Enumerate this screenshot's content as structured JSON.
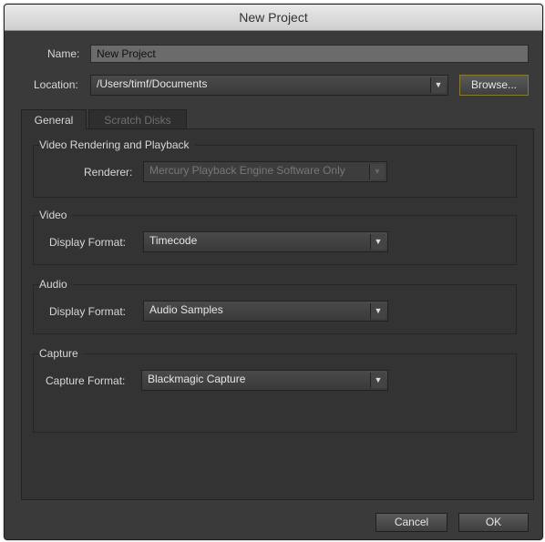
{
  "window": {
    "title": "New Project"
  },
  "name": {
    "label": "Name:",
    "value": "New Project"
  },
  "location": {
    "label": "Location:",
    "value": "/Users/timf/Documents",
    "browse_label": "Browse..."
  },
  "tabs": [
    {
      "label": "General",
      "active": true
    },
    {
      "label": "Scratch Disks",
      "active": false
    }
  ],
  "sections": {
    "rendering": {
      "title": "Video Rendering and Playback",
      "renderer_label": "Renderer:",
      "renderer_value": "Mercury Playback Engine Software Only"
    },
    "video": {
      "title": "Video",
      "format_label": "Display Format:",
      "format_value": "Timecode"
    },
    "audio": {
      "title": "Audio",
      "format_label": "Display Format:",
      "format_value": "Audio Samples"
    },
    "capture": {
      "title": "Capture",
      "format_label": "Capture Format:",
      "format_value": "Blackmagic Capture"
    }
  },
  "footer": {
    "cancel_label": "Cancel",
    "ok_label": "OK"
  },
  "icons": {
    "dropdown": "chevron-down-icon",
    "dropdown_glyph": "▼"
  }
}
